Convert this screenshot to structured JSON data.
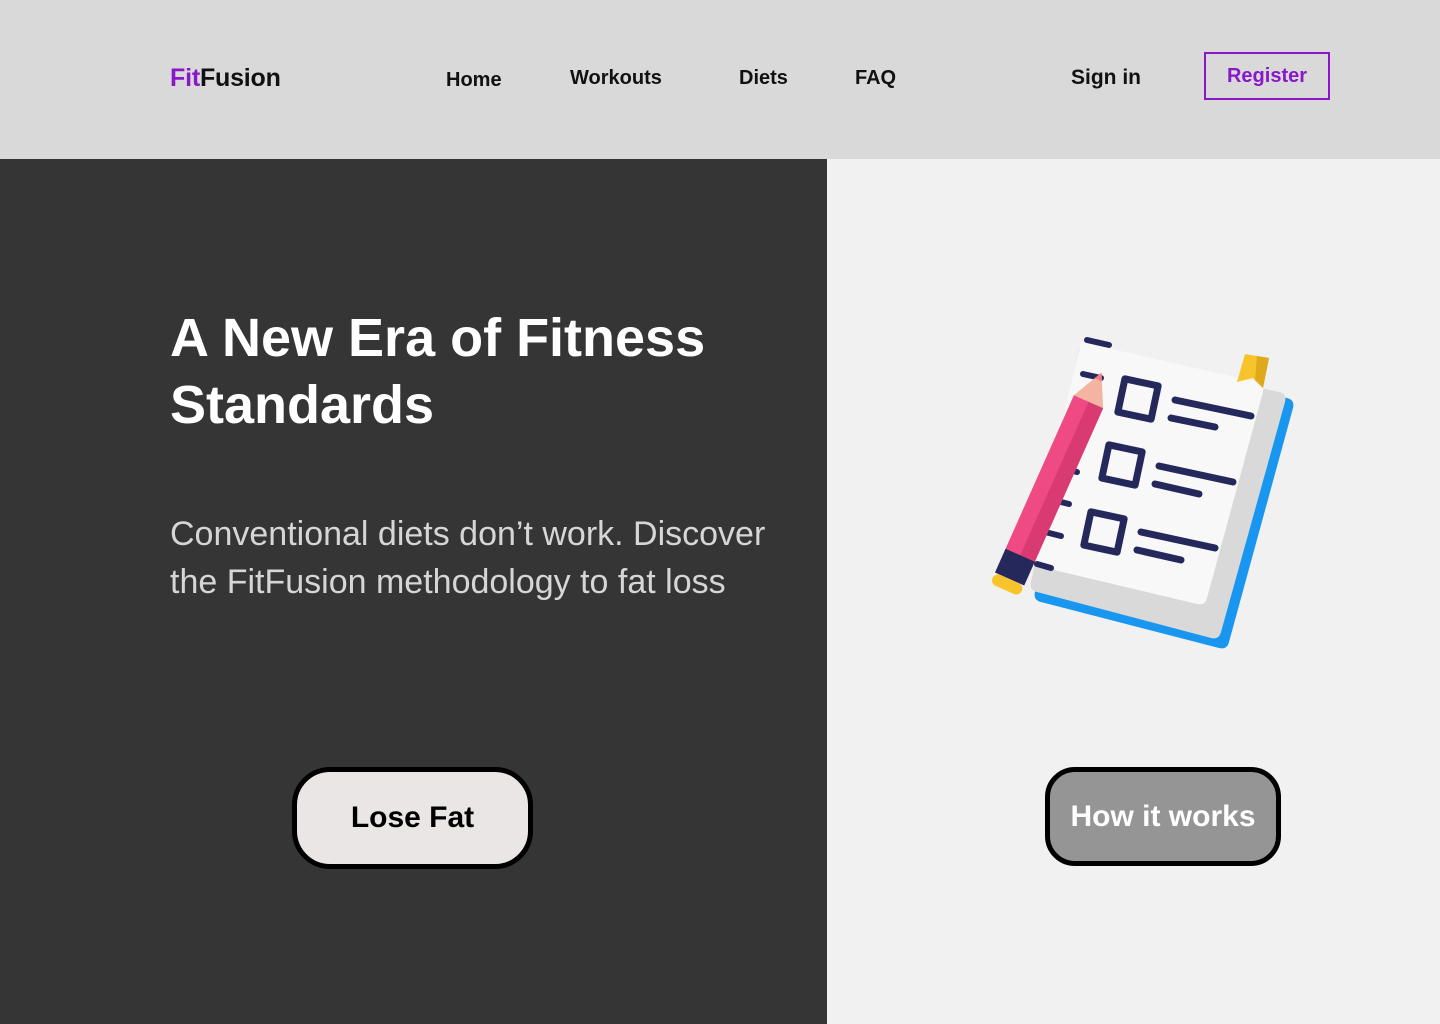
{
  "header": {
    "logo_accent": "Fit",
    "logo_rest": "Fusion",
    "nav": [
      "Home",
      "Workouts",
      "Diets",
      "FAQ"
    ],
    "sign_in": "Sign in",
    "register": "Register"
  },
  "hero": {
    "headline": "A New Era of Fitness Standards",
    "subtext": "Conventional diets don’t work. Discover the FitFusion methodology to fat loss",
    "primary_button": "Lose Fat",
    "secondary_button": "How it works",
    "illustration": "checklist-notebook-pencil-icon"
  },
  "colors": {
    "brand": "#8a18c9",
    "header_bg": "#d9d9d9",
    "hero_dark": "#353535",
    "hero_light": "#f1f1f1"
  }
}
